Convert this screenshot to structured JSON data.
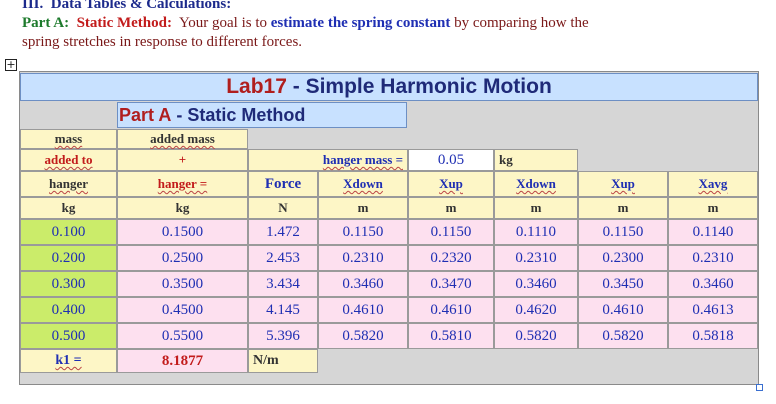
{
  "doc": {
    "heading_num": "III.",
    "heading_text": "Data Tables & Calculations:",
    "part_label": "Part A:",
    "method_label": "Static Method:",
    "text1": "Your goal is to",
    "bold_phrase": "estimate the spring constant",
    "text2": "by comparing how the",
    "line3": "spring stretches in response to different forces."
  },
  "sheet": {
    "title_lab": "Lab17",
    "title_rest": "- Simple Harmonic Motion",
    "sub_part": "Part A",
    "sub_rest": "- Static Method",
    "col1": {
      "h1": "mass",
      "h2": "added to",
      "h3": "hanger",
      "unit": "kg"
    },
    "col2": {
      "h1": "added mass",
      "h2": "+",
      "h3": "hanger =",
      "unit": "kg"
    },
    "hanger_label": "hanger mass =",
    "hanger_value": "0.05",
    "hanger_unit": "kg",
    "force_label": "Force",
    "force_unit": "N",
    "xdown_label": "Xdown",
    "xup_label": "Xup",
    "xavg_label": "Xavg",
    "m_unit": "m",
    "rows": [
      [
        "0.100",
        "0.1500",
        "1.472",
        "0.1150",
        "0.1150",
        "0.1110",
        "0.1150",
        "0.1140"
      ],
      [
        "0.200",
        "0.2500",
        "2.453",
        "0.2310",
        "0.2320",
        "0.2310",
        "0.2300",
        "0.2310"
      ],
      [
        "0.300",
        "0.3500",
        "3.434",
        "0.3460",
        "0.3470",
        "0.3460",
        "0.3450",
        "0.3460"
      ],
      [
        "0.400",
        "0.4500",
        "4.145",
        "0.4610",
        "0.4610",
        "0.4620",
        "0.4610",
        "0.4613"
      ],
      [
        "0.500",
        "0.5500",
        "5.396",
        "0.5820",
        "0.5810",
        "0.5820",
        "0.5820",
        "0.5818"
      ]
    ],
    "k_label": "k1 =",
    "k_value": "8.1877",
    "k_unit": "N/m"
  },
  "icons": {
    "anchor": "move-anchor-icon"
  }
}
